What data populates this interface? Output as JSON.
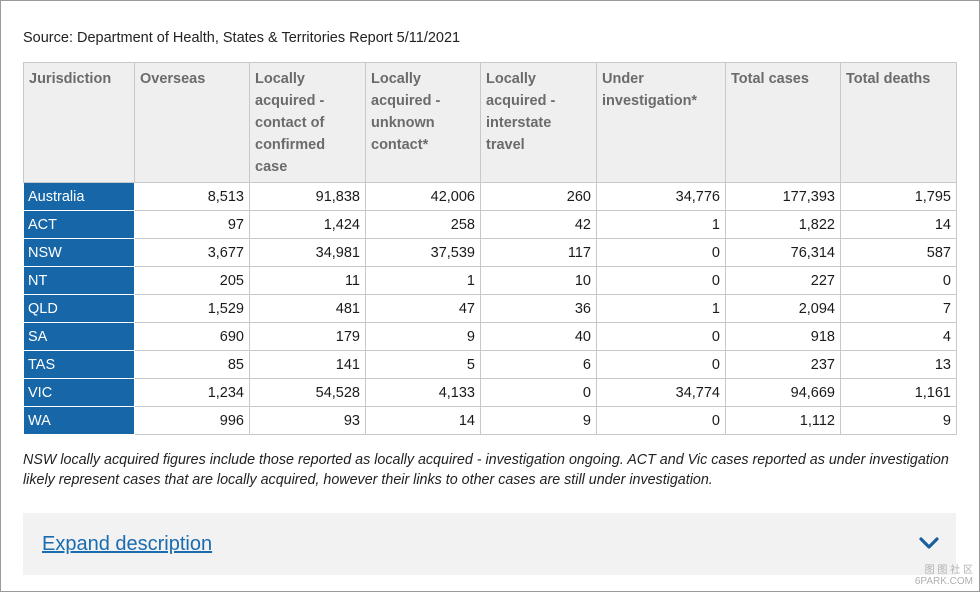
{
  "source": "Source: Department of Health, States & Territories Report 5/11/2021",
  "table": {
    "headers": [
      "Jurisdiction",
      "Overseas",
      "Locally acquired - contact of confirmed case",
      "Locally acquired - unknown contact*",
      "Locally acquired - interstate travel",
      "Under investigation*",
      "Total cases",
      "Total deaths"
    ],
    "rows": [
      [
        "Australia",
        "8,513",
        "91,838",
        "42,006",
        "260",
        "34,776",
        "177,393",
        "1,795"
      ],
      [
        "ACT",
        "97",
        "1,424",
        "258",
        "42",
        "1",
        "1,822",
        "14"
      ],
      [
        "NSW",
        "3,677",
        "34,981",
        "37,539",
        "117",
        "0",
        "76,314",
        "587"
      ],
      [
        "NT",
        "205",
        "11",
        "1",
        "10",
        "0",
        "227",
        "0"
      ],
      [
        "QLD",
        "1,529",
        "481",
        "47",
        "36",
        "1",
        "2,094",
        "7"
      ],
      [
        "SA",
        "690",
        "179",
        "9",
        "40",
        "0",
        "918",
        "4"
      ],
      [
        "TAS",
        "85",
        "141",
        "5",
        "6",
        "0",
        "237",
        "13"
      ],
      [
        "VIC",
        "1,234",
        "54,528",
        "4,133",
        "0",
        "34,774",
        "94,669",
        "1,161"
      ],
      [
        "WA",
        "996",
        "93",
        "14",
        "9",
        "0",
        "1,112",
        "9"
      ]
    ]
  },
  "note": "NSW locally acquired figures include those reported as locally acquired - investigation ongoing. ACT and Vic cases reported as under investigation likely represent cases that are locally acquired, however their links to other cases are still under investigation.",
  "expand": {
    "label": "Expand description",
    "icon": "chevron-down-icon"
  },
  "watermark": {
    "line1": "图 图 社 区",
    "line2": "6PARK.COM"
  },
  "colors": {
    "jurisdiction_cell": "#1666a8",
    "header_bg": "#efefef",
    "link": "#1a6bb0",
    "chevron": "#1a5f9e"
  }
}
